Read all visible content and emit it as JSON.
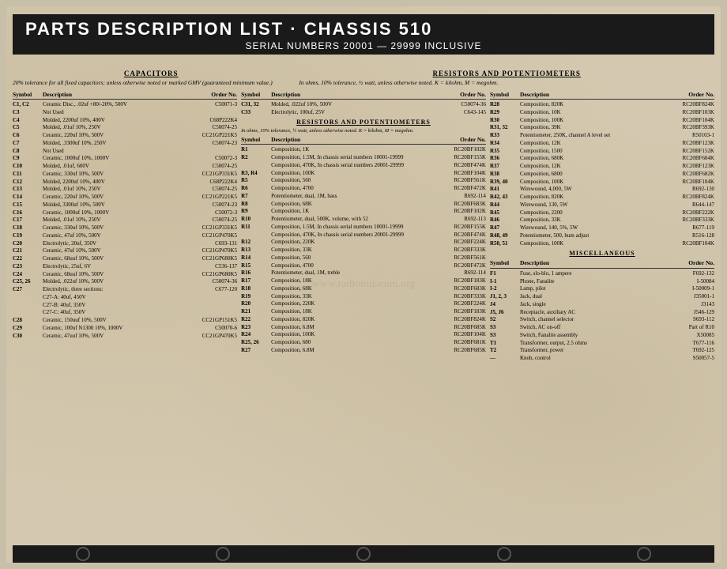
{
  "header": {
    "title": "PARTS DESCRIPTION LIST  ·  CHASSIS  510",
    "subtitle": "SERIAL NUMBERS  20001 — 29999  INCLUSIVE"
  },
  "capacitors_section": {
    "label": "CAPACITORS",
    "note": "20% tolerance for all fixed capacitors; unless otherwise noted or marked GMV (guaranteed minimum value.)"
  },
  "resistors_section": {
    "label": "RESISTORS AND POTENTIOMETERS",
    "note": "In ohms, 10% tolerance, ½ watt, unless otherwise noted. K = kilohm, M = megohm."
  },
  "col1_header": {
    "sym": "Symbol",
    "desc": "Description",
    "ord": "Order No."
  },
  "capacitors": [
    {
      "sym": "C1, C2",
      "desc": "Ceramic Disc., .02uf +80/-20%, 500V",
      "ord": "C50071-3"
    },
    {
      "sym": "C3",
      "desc": "Not Used",
      "ord": ""
    },
    {
      "sym": "C4",
      "desc": "Molded, 2200uf 10%, 400V",
      "ord": "C68P222K4"
    },
    {
      "sym": "C5",
      "desc": "Molded, .01uf 10%, 250V",
      "ord": "C50074-25"
    },
    {
      "sym": "C6",
      "desc": "Ceramic, 220uf 10%, 500V",
      "ord": "CC21GP221K5"
    },
    {
      "sym": "C7",
      "desc": "Molded, .3300uf 10%, 250V",
      "ord": "C50074-23"
    },
    {
      "sym": "C8",
      "desc": "Not Used",
      "ord": ""
    },
    {
      "sym": "C9",
      "desc": "Ceramic, 1000uf 10%, 1000V",
      "ord": "C50072-3"
    },
    {
      "sym": "C10",
      "desc": "Molded, .01uf, 600V",
      "ord": "C50074-25"
    },
    {
      "sym": "C11",
      "desc": "Ceramic, 330uf 10%, 500V",
      "ord": "CC21GP331K5"
    },
    {
      "sym": "C12",
      "desc": "Molded, 2200uf 10%, 400V",
      "ord": "C68P222K4"
    },
    {
      "sym": "C13",
      "desc": "Molded, .01uf 10%, 250V",
      "ord": "C50074-25"
    },
    {
      "sym": "C14",
      "desc": "Ceramic, 220uf 10%, 500V",
      "ord": "CC21GP221K5"
    },
    {
      "sym": "C15",
      "desc": "Molded, 3300uf 10%, 500V",
      "ord": "C50074-23"
    },
    {
      "sym": "C16",
      "desc": "Ceramic, 1000uf 10%, 1000V",
      "ord": "C50072-3"
    },
    {
      "sym": "C17",
      "desc": "Molded, .01uf 10%, 250V",
      "ord": "C50074-25"
    },
    {
      "sym": "C18",
      "desc": "Ceramic, 330uf 10%, 500V",
      "ord": "CC21GP331K5"
    },
    {
      "sym": "C19",
      "desc": "Ceramic, 47uf 10%, 500V",
      "ord": "CC21GP470K5"
    },
    {
      "sym": "C20",
      "desc": "Electrolytic, 20uf, 350V",
      "ord": "C693-131"
    },
    {
      "sym": "C21",
      "desc": "Ceramic, 47uf 10%, 500V",
      "ord": "CC21GP470K5"
    },
    {
      "sym": "C22",
      "desc": "Ceramic, 68uuf 10%, 500V",
      "ord": "CC21GP680K5"
    },
    {
      "sym": "C23",
      "desc": "Electrolytic, 25uf, 6V",
      "ord": "C536-137"
    },
    {
      "sym": "C24",
      "desc": "Ceramic, 68uuf 10%, 500V",
      "ord": "CC21GP680K5"
    },
    {
      "sym": "C25, 26",
      "desc": "Molded, .022uf 10%, 500V",
      "ord": "C50074-36"
    },
    {
      "sym": "C27",
      "desc": "Electrolytic, three sections:",
      "ord": "C677-120"
    },
    {
      "sym": "",
      "desc": "C27-A: 40uf, 450V",
      "ord": ""
    },
    {
      "sym": "",
      "desc": "C27-B: 40uf, 350V",
      "ord": ""
    },
    {
      "sym": "",
      "desc": "C27-C: 40uf, 350V",
      "ord": ""
    },
    {
      "sym": "C28",
      "desc": "Ceramic, 150uuf 10%, 500V",
      "ord": "CC21GP151K5"
    },
    {
      "sym": "C29",
      "desc": "Ceramic, 100uf N1300 10%, 1000V",
      "ord": "C50070-6"
    },
    {
      "sym": "C30",
      "desc": "Ceramic, 47uuf 10%, 500V",
      "ord": "CC21GP470K5"
    }
  ],
  "col2_items": [
    {
      "sym": "C31, 32",
      "desc": "Molded, .022uf 10%, 500V",
      "ord": "C50074-36"
    },
    {
      "sym": "C33",
      "desc": "Electrolytic, 100uf, 25V",
      "ord": "C643-145"
    }
  ],
  "resistors": [
    {
      "sym": "R1",
      "desc": "Composition, 1K",
      "ord": "RC20BF102K"
    },
    {
      "sym": "R2",
      "desc": "Composition, 1.5M, In chassis serial numbers 10001-19999",
      "ord": "RC20BF155K"
    },
    {
      "sym": "",
      "desc": "Composition, 470K, In chassis serial numbers 20001-29999",
      "ord": "RC20BF474K"
    },
    {
      "sym": "R3, R4",
      "desc": "Composition, 100K",
      "ord": "RC20BF104K"
    },
    {
      "sym": "R5",
      "desc": "Composition, 560",
      "ord": "RC20BF561K"
    },
    {
      "sym": "R6",
      "desc": "Composition, 4700",
      "ord": "RC20BF472K"
    },
    {
      "sym": "R7",
      "desc": "Potentiometer, dual, 1M, bass",
      "ord": "R692-114"
    },
    {
      "sym": "R8",
      "desc": "Composition, 68K",
      "ord": "RC20BF683K"
    },
    {
      "sym": "R9",
      "desc": "Composition, 1K",
      "ord": "RC20BF102K"
    },
    {
      "sym": "R10",
      "desc": "Potentiometer, dual, 500K, volume, with 52",
      "ord": "R692-113"
    },
    {
      "sym": "R11",
      "desc": "Composition, 1.5M, In chassis serial numbers 10001-19999",
      "ord": "RC20BF155K"
    },
    {
      "sym": "",
      "desc": "Composition, 470K, In chassis serial numbers 20001-29999",
      "ord": "RC20BF474K"
    },
    {
      "sym": "R12",
      "desc": "Composition, 220K",
      "ord": "RC20BF224K"
    },
    {
      "sym": "R13",
      "desc": "Composition, 33K",
      "ord": "RC20BF333K"
    },
    {
      "sym": "R14",
      "desc": "Composition, 560",
      "ord": "RC20BF561K"
    },
    {
      "sym": "R15",
      "desc": "Composition, 4700",
      "ord": "RC20BF472K"
    },
    {
      "sym": "R16",
      "desc": "Potentiometer, dual, 1M, treble",
      "ord": "R692-114"
    },
    {
      "sym": "R17",
      "desc": "Composition, 18K",
      "ord": "RC20BF183K"
    },
    {
      "sym": "R18",
      "desc": "Composition, 68K",
      "ord": "RC20BF683K"
    },
    {
      "sym": "R19",
      "desc": "Composition, 33K",
      "ord": "RC20BF333K"
    },
    {
      "sym": "R20",
      "desc": "Composition, 220K",
      "ord": "RC20BF224K"
    },
    {
      "sym": "R21",
      "desc": "Composition, 18K",
      "ord": "RC20BF183K"
    },
    {
      "sym": "R22",
      "desc": "Composition, 820K",
      "ord": "RC20BF824K"
    },
    {
      "sym": "R23",
      "desc": "Composition, 6.8M",
      "ord": "RC20BF685K"
    },
    {
      "sym": "R24",
      "desc": "Composition, 100K",
      "ord": "RC20BF104K"
    },
    {
      "sym": "R25, 26",
      "desc": "Composition, 680",
      "ord": "RC20BF681K"
    },
    {
      "sym": "R27",
      "desc": "Composition, 6.8M",
      "ord": "RC20BF685K"
    }
  ],
  "col3_resistors": [
    {
      "sym": "R28",
      "desc": "Composition, 820K",
      "ord": "RC20BF824K"
    },
    {
      "sym": "R29",
      "desc": "Composition, 10K",
      "ord": "RC20BF103K"
    },
    {
      "sym": "R30",
      "desc": "Composition, 100K",
      "ord": "RC20BF104K"
    },
    {
      "sym": "R31, 32",
      "desc": "Composition, 39K",
      "ord": "RC20BF393K"
    },
    {
      "sym": "R33",
      "desc": "Potentiometer, 250K, channel A level set",
      "ord": "R50103-1"
    },
    {
      "sym": "R34",
      "desc": "Composition, 12K",
      "ord": "RC20BF123K"
    },
    {
      "sym": "R35",
      "desc": "Composition, 1500",
      "ord": "RC20BF152K"
    },
    {
      "sym": "R36",
      "desc": "Composition, 680K",
      "ord": "RC20BF684K"
    },
    {
      "sym": "R37",
      "desc": "Composition, 12K",
      "ord": "RC20BF123K"
    },
    {
      "sym": "R38",
      "desc": "Composition, 6800",
      "ord": "RC20BF682K"
    },
    {
      "sym": "R39, 40",
      "desc": "Composition, 100K",
      "ord": "RC20BF104K"
    },
    {
      "sym": "R41",
      "desc": "Wirewound, 4,000, 5W",
      "ord": "R692-130"
    },
    {
      "sym": "R42, 43",
      "desc": "Composition, 820K",
      "ord": "RC20BF824K"
    },
    {
      "sym": "R44",
      "desc": "Wirewound, 130, 5W",
      "ord": "R644-147"
    },
    {
      "sym": "R45",
      "desc": "Composition, 2200",
      "ord": "RC20BF222K"
    },
    {
      "sym": "R46",
      "desc": "Composition, 33K",
      "ord": "RC20BF333K"
    },
    {
      "sym": "R47",
      "desc": "Wirewound, 140, 5%, 5W",
      "ord": "R677-119"
    },
    {
      "sym": "R48, 49",
      "desc": "Potentiometer, 500, hum adjust",
      "ord": "R516-128"
    },
    {
      "sym": "R50, 51",
      "desc": "Composition, 100K",
      "ord": "RC20BF104K"
    }
  ],
  "misc_section": {
    "label": "MISCELLANEOUS",
    "items": [
      {
        "sym": "F1",
        "desc": "Fuse, slo-blo, 1 ampere",
        "ord": "F692-132"
      },
      {
        "sym": "I-1",
        "desc": "Phone, Fanalite",
        "ord": "I-50084"
      },
      {
        "sym": "I-2",
        "desc": "Lamp, pilot",
        "ord": "I-50009-1"
      },
      {
        "sym": "J1, 2, 3",
        "desc": "Jack, dual",
        "ord": "J35001-1"
      },
      {
        "sym": "J4",
        "desc": "Jack, single",
        "ord": "J3143"
      },
      {
        "sym": "J5, J6",
        "desc": "Receptacle, auxiliary AC",
        "ord": "J546-129"
      },
      {
        "sym": "S2",
        "desc": "Switch, channel selector",
        "ord": "S693-112"
      },
      {
        "sym": "S3",
        "desc": "Switch, AC on-off",
        "ord": "Part of R10"
      },
      {
        "sym": "S3",
        "desc": "Switch, Fanalite assembly",
        "ord": "X50085"
      },
      {
        "sym": "T1",
        "desc": "Transformer, output, 2.5 ohms",
        "ord": "T677-116"
      },
      {
        "sym": "T2",
        "desc": "Transformer, power",
        "ord": "T692-125"
      },
      {
        "sym": "—",
        "desc": "Knob, control",
        "ord": "S50057-5"
      }
    ]
  },
  "watermark": "www.radiomuseum.org"
}
